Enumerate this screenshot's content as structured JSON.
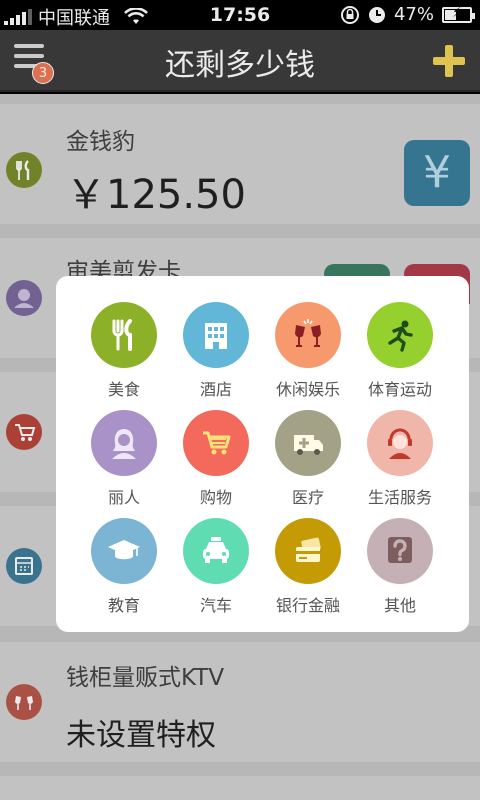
{
  "status_bar": {
    "carrier": "中国联通",
    "time": "17:56",
    "battery": "47%",
    "battery_level": 0.47
  },
  "nav": {
    "title": "还剩多少钱",
    "badge_count": "3"
  },
  "cards": [
    {
      "name": "金钱豹",
      "value": "￥125.50",
      "icon": "dining-icon",
      "color": "#7b8f2d"
    },
    {
      "name": "审美剪发卡",
      "icon": "person-icon",
      "color": "#7c6aa0"
    },
    {
      "icon": "cart-icon",
      "color": "#b9463b"
    },
    {
      "icon": "calendar-icon",
      "color": "#3f7d9a"
    },
    {
      "name": "钱柜量贩式KTV",
      "sub": "未设置特权",
      "icon": "cheers-icon",
      "color": "#b9574b"
    }
  ],
  "categories": [
    {
      "label": "美食",
      "icon": "fork-knife-icon",
      "color": "#8cb027"
    },
    {
      "label": "酒店",
      "icon": "hotel-icon",
      "color": "#62b7d8"
    },
    {
      "label": "休闲娱乐",
      "icon": "wine-glasses-icon",
      "color": "#f69a6e"
    },
    {
      "label": "体育运动",
      "icon": "runner-icon",
      "color": "#95d02f"
    },
    {
      "label": "丽人",
      "icon": "woman-icon",
      "color": "#a892c7"
    },
    {
      "label": "购物",
      "icon": "shopping-cart-icon",
      "color": "#f36a5c"
    },
    {
      "label": "医疗",
      "icon": "ambulance-icon",
      "color": "#a3a287"
    },
    {
      "label": "生活服务",
      "icon": "headset-person-icon",
      "color": "#f0b6aa"
    },
    {
      "label": "教育",
      "icon": "graduation-cap-icon",
      "color": "#7cb4d3"
    },
    {
      "label": "汽车",
      "icon": "car-icon",
      "color": "#5fdcb1"
    },
    {
      "label": "银行金融",
      "icon": "bank-card-icon",
      "color": "#c49a05"
    },
    {
      "label": "其他",
      "icon": "question-icon",
      "color": "#c5b1b5"
    }
  ]
}
